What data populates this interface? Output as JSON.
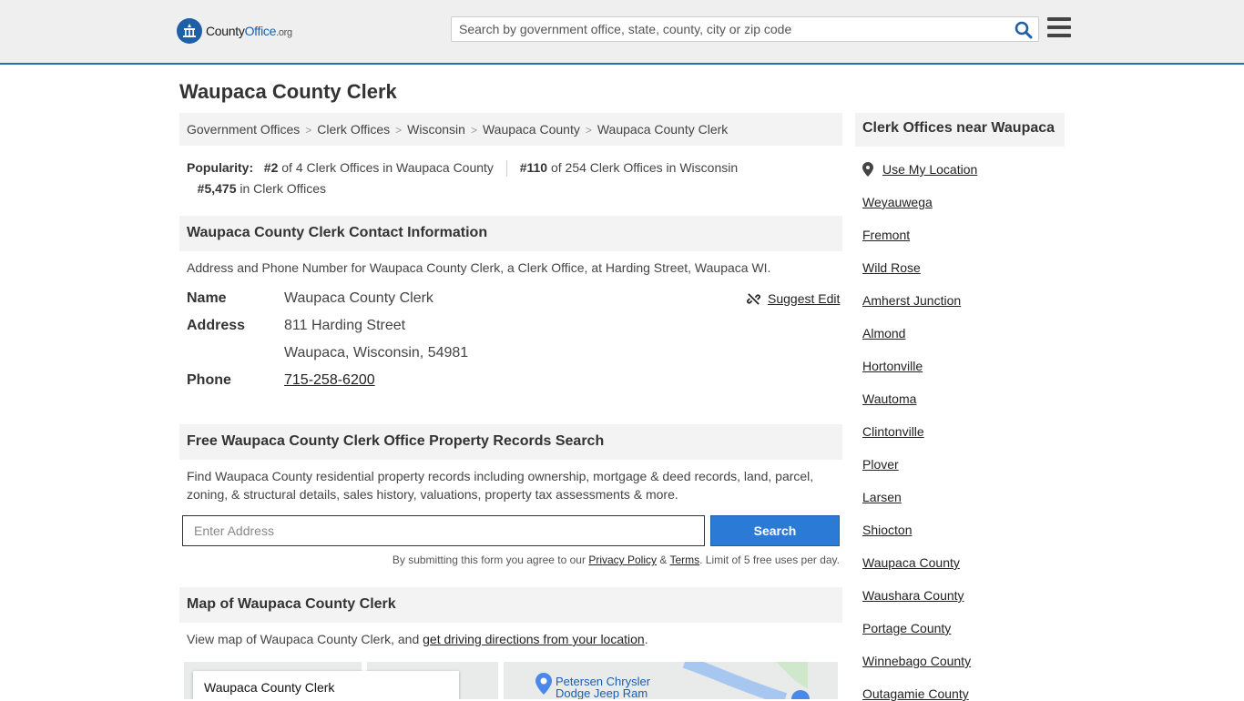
{
  "header": {
    "logo_text_county": "County",
    "logo_text_office": "Office",
    "logo_text_org": ".org",
    "search_placeholder": "Search by government office, state, county, city or zip code"
  },
  "page_title": "Waupaca County Clerk",
  "breadcrumb": [
    "Government Offices",
    "Clerk Offices",
    "Wisconsin",
    "Waupaca County",
    "Waupaca County Clerk"
  ],
  "breadcrumb_separator": ">",
  "popularity": {
    "label": "Popularity:",
    "rank1": "#2",
    "rank1_text": "of 4 Clerk Offices in Waupaca County",
    "rank2": "#110",
    "rank2_text": "of 254 Clerk Offices in Wisconsin",
    "rank3": "#5,475",
    "rank3_text": "in Clerk Offices"
  },
  "contact": {
    "heading": "Waupaca County Clerk Contact Information",
    "intro": "Address and Phone Number for Waupaca County Clerk, a Clerk Office, at Harding Street, Waupaca WI.",
    "name_label": "Name",
    "name": "Waupaca County Clerk",
    "address_label": "Address",
    "address_line1": "811 Harding Street",
    "address_line2": "Waupaca, Wisconsin, 54981",
    "phone_label": "Phone",
    "phone": "715-258-6200",
    "suggest_edit": "Suggest Edit"
  },
  "records": {
    "heading": "Free Waupaca County Clerk Office Property Records Search",
    "description": "Find Waupaca County residential property records including ownership, mortgage & deed records, land, parcel, zoning, & structural details, sales history, valuations, property tax assessments & more.",
    "input_placeholder": "Enter Address",
    "button": "Search",
    "disclaimer_prefix": "By submitting this form you agree to our ",
    "privacy_link": "Privacy Policy",
    "amp": " & ",
    "terms_link": "Terms",
    "disclaimer_suffix": ". Limit of 5 free uses per day."
  },
  "map_section": {
    "heading": "Map of Waupaca County Clerk",
    "intro_prefix": "View map of Waupaca County Clerk, and ",
    "directions_link": "get driving directions from your location",
    "intro_suffix": ".",
    "card_title": "Waupaca County Clerk",
    "poi_line1": "Petersen Chrysler",
    "poi_line2": "Dodge Jeep Ram"
  },
  "sidebar": {
    "heading": "Clerk Offices near Waupaca",
    "use_location": "Use My Location",
    "items": [
      "Weyauwega",
      "Fremont",
      "Wild Rose",
      "Amherst Junction",
      "Almond",
      "Hortonville",
      "Wautoma",
      "Clintonville",
      "Plover",
      "Larsen",
      "Shiocton",
      "Waupaca County",
      "Waushara County",
      "Portage County",
      "Winnebago County",
      "Outagamie County"
    ]
  },
  "colors": {
    "brand_blue": "#1f5fa8",
    "button_blue": "#2b7ad6",
    "header_bg": "#efefef",
    "panel_bg": "#f3f3f3"
  }
}
